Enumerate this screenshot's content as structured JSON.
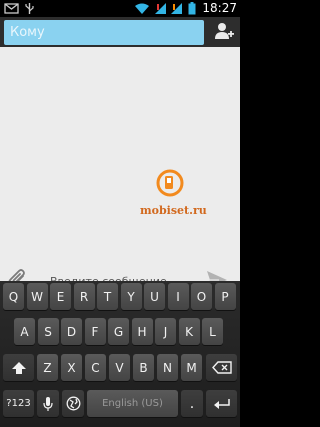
{
  "status_bar": {
    "time": "18:27",
    "icons": [
      "email-icon",
      "usb-icon",
      "wifi-icon",
      "signal-icon-1",
      "signal-icon-2",
      "battery-icon"
    ]
  },
  "header": {
    "recipient_placeholder": "Кому",
    "add_contact_icon": "add-contact-icon",
    "accent_color": "#8ad2f0"
  },
  "conversation": {
    "watermark_text": "mobiset.ru"
  },
  "compose": {
    "attach_icon": "paperclip-icon",
    "message_placeholder": "Введите сообщение",
    "send_icon": "send-icon"
  },
  "keyboard": {
    "row1": [
      "Q",
      "W",
      "E",
      "R",
      "T",
      "Y",
      "U",
      "I",
      "O",
      "P"
    ],
    "row2": [
      "A",
      "S",
      "D",
      "F",
      "G",
      "H",
      "J",
      "K",
      "L"
    ],
    "row3": [
      "Z",
      "X",
      "C",
      "V",
      "B",
      "N",
      "M"
    ],
    "shift_icon": "shift-icon",
    "delete_icon": "delete-icon",
    "symbols_label": "?123",
    "mic_icon": "microphone-icon",
    "globe_icon": "globe-icon",
    "space_label": "English (US)",
    "period_label": ".",
    "enter_icon": "enter-icon"
  }
}
